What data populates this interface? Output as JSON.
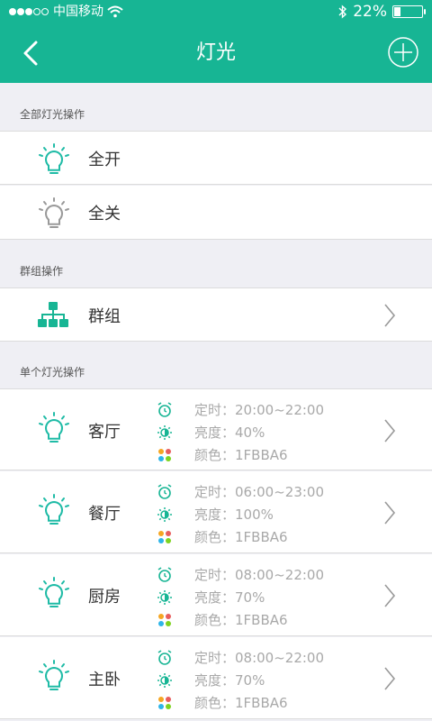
{
  "status_bar": {
    "carrier": "中国移动",
    "battery_text": "22%",
    "battery_level": 0.22
  },
  "nav": {
    "title": "灯光"
  },
  "sections": {
    "all": "全部灯光操作",
    "group": "群组操作",
    "single": "单个灯光操作"
  },
  "all_ops": [
    {
      "label": "全开",
      "icon": "bulb-on-icon"
    },
    {
      "label": "全关",
      "icon": "bulb-off-icon"
    }
  ],
  "group": {
    "label": "群组",
    "icon": "group-tree-icon"
  },
  "rooms": [
    {
      "name": "客厅",
      "timer": "定时：20:00~22:00",
      "brightness": "亮度：40%",
      "color": "颜色：1FBBA6"
    },
    {
      "name": "餐厅",
      "timer": "定时：06:00~23:00",
      "brightness": "亮度：100%",
      "color": "颜色：1FBBA6"
    },
    {
      "name": "厨房",
      "timer": "定时：08:00~22:00",
      "brightness": "亮度：70%",
      "color": "颜色：1FBBA6"
    },
    {
      "name": "主卧",
      "timer": "定时：08:00~22:00",
      "brightness": "亮度：70%",
      "color": "颜色：1FBBA6"
    }
  ],
  "colors": {
    "accent": "#17b594",
    "bulb_on": "#1fbba6",
    "bulb_off": "#999999"
  }
}
